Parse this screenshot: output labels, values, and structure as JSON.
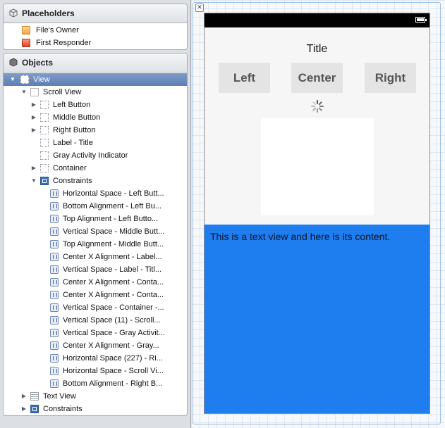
{
  "placeholders": {
    "header": "Placeholders",
    "items": [
      {
        "label": "File's Owner",
        "icon": "cube-orange-icon"
      },
      {
        "label": "First Responder",
        "icon": "cube-red-icon"
      }
    ]
  },
  "objects": {
    "header": "Objects",
    "rows": [
      {
        "label": "View"
      },
      {
        "label": "Scroll View"
      },
      {
        "label": "Left Button"
      },
      {
        "label": "Middle Button"
      },
      {
        "label": "Right Button"
      },
      {
        "label": "Label - Title"
      },
      {
        "label": "Gray Activity Indicator"
      },
      {
        "label": "Container"
      },
      {
        "label": "Constraints"
      },
      {
        "label": "Horizontal Space - Left Butt..."
      },
      {
        "label": "Bottom Alignment - Left Bu..."
      },
      {
        "label": "Top Alignment - Left Butto..."
      },
      {
        "label": "Vertical Space - Middle Butt..."
      },
      {
        "label": "Top Alignment - Middle Butt..."
      },
      {
        "label": "Center X Alignment - Label..."
      },
      {
        "label": "Vertical Space - Label - Titl..."
      },
      {
        "label": "Center X Alignment - Conta..."
      },
      {
        "label": "Center X Alignment - Conta..."
      },
      {
        "label": "Vertical Space - Container -..."
      },
      {
        "label": "Vertical Space (11) - Scroll..."
      },
      {
        "label": "Vertical Space - Gray Activit..."
      },
      {
        "label": "Center X Alignment - Gray..."
      },
      {
        "label": "Horizontal Space (227) - Ri..."
      },
      {
        "label": "Horizontal Space - Scroll Vi..."
      },
      {
        "label": "Bottom Alignment - Right B..."
      },
      {
        "label": "Text View"
      },
      {
        "label": "Constraints"
      }
    ]
  },
  "device": {
    "title": "Title",
    "buttons": {
      "left": "Left",
      "center": "Center",
      "right": "Right"
    },
    "text_view_content": "This is a text view and here is its content.",
    "text_view_color": "#1e7ef0"
  },
  "colors": {
    "selection": "#6787bd",
    "constraint_icon": "#3d6fb3"
  }
}
